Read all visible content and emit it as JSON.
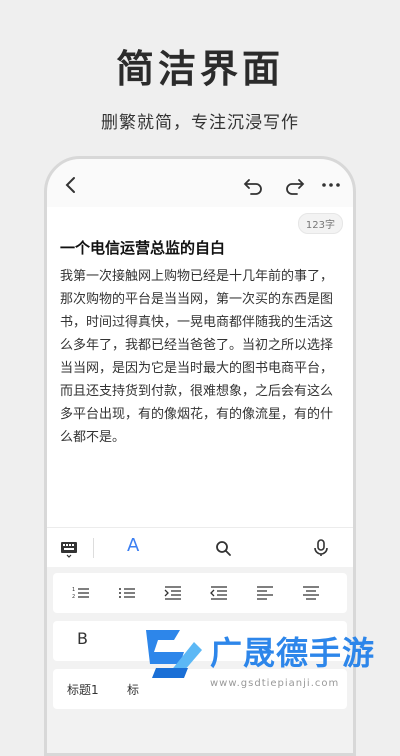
{
  "header": {
    "headline": "简洁界面",
    "subline": "删繁就简，专注沉浸写作"
  },
  "editor": {
    "word_count": "123字",
    "title": "一个电信运营总监的自白",
    "body": "我第一次接触网上购物已经是十几年前的事了，那次购物的平台是当当网，第一次买的东西是图书，时间过得真快，一晃电商都伴随我的生活这么多年了，我都已经当爸爸了。当初之所以选择当当网，是因为它是当时最大的图书电商平台，而且还支持货到付款，很难想象，之后会有这么多平台出现，有的像烟花，有的像流星，有的什么都不是。"
  },
  "toolbar": {
    "font_label": "A"
  },
  "format_panel": {
    "bold_label": "B",
    "heading1_label": "标题1",
    "heading2_label": "标"
  },
  "watermark": {
    "brand": "广晟德手游",
    "url": "www.gsdtiepianji.com"
  },
  "colors": {
    "accent": "#3b7ff2",
    "brand_blue": "#2d86ea"
  },
  "icons": [
    "back-icon",
    "undo-icon",
    "redo-icon",
    "more-icon",
    "keyboard-icon",
    "search-icon",
    "mic-icon",
    "ordered-list-icon",
    "bullet-list-icon",
    "indent-icon",
    "outdent-icon",
    "align-left-icon",
    "align-center-icon"
  ]
}
